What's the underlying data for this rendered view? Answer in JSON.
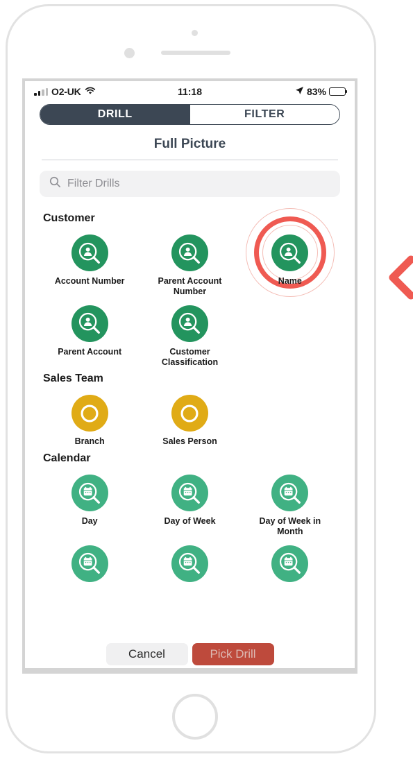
{
  "status_bar": {
    "carrier": "O2-UK",
    "wifi_icon": "wifi-icon",
    "time": "11:18",
    "location_icon": "location-arrow-icon",
    "battery_percent": "83%",
    "battery_level": 83
  },
  "segmented_control": {
    "options": [
      {
        "label": "DRILL",
        "selected": true
      },
      {
        "label": "FILTER",
        "selected": false
      }
    ],
    "selected_color": "#3c4754"
  },
  "sheet": {
    "title": "Full Picture"
  },
  "search": {
    "placeholder": "Filter Drills",
    "value": "",
    "icon": "search-icon"
  },
  "groups": [
    {
      "title": "Customer",
      "icon_type": "person-search-icon",
      "icon_color": "#23945e",
      "items": [
        {
          "label": "Account Number",
          "highlighted": false
        },
        {
          "label": "Parent Account Number",
          "highlighted": false
        },
        {
          "label": "Name",
          "highlighted": true
        },
        {
          "label": "Parent Account",
          "highlighted": false
        },
        {
          "label": "Customer Classification",
          "highlighted": false
        }
      ]
    },
    {
      "title": "Sales Team",
      "icon_type": "ring-icon",
      "icon_color": "#e0ab16",
      "items": [
        {
          "label": "Branch",
          "highlighted": false
        },
        {
          "label": "Sales Person",
          "highlighted": false
        }
      ]
    },
    {
      "title": "Calendar",
      "icon_type": "calendar-search-icon",
      "icon_color": "#40b183",
      "items": [
        {
          "label": "Day",
          "highlighted": false
        },
        {
          "label": "Day of Week",
          "highlighted": false
        },
        {
          "label": "Day of Week in Month",
          "highlighted": false
        },
        {
          "label": "",
          "highlighted": false
        },
        {
          "label": "",
          "highlighted": false
        },
        {
          "label": "",
          "highlighted": false
        }
      ]
    }
  ],
  "highlight": {
    "ring_color": "#ef5a52",
    "ring_color_faint": "#f4bdb6",
    "pointer_icon": "chevron-left-icon",
    "pointer_color": "#ef5a52"
  },
  "actions": {
    "cancel_label": "Cancel",
    "pick_label": "Pick Drill",
    "pick_color": "#be4a3c",
    "pick_enabled": false
  }
}
